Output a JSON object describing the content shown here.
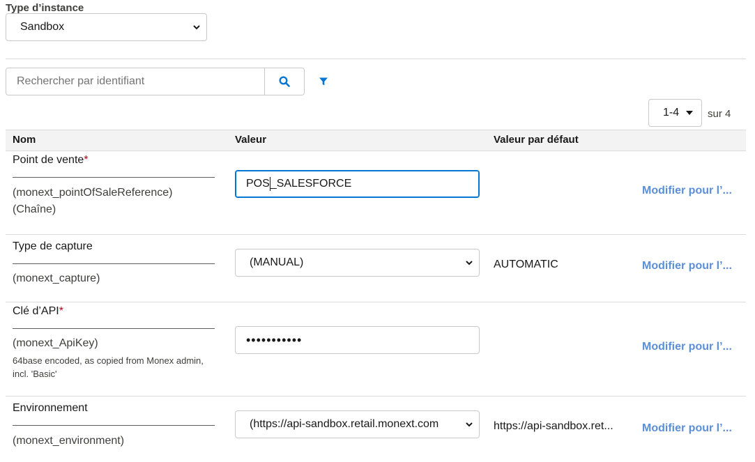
{
  "instance": {
    "label": "Type d’instance",
    "selected": "Sandbox"
  },
  "search": {
    "placeholder": "Rechercher par identifiant"
  },
  "icons": {
    "search": "search-icon",
    "filter": "filter-icon",
    "chevron": "chevron-down-icon"
  },
  "pagination": {
    "range": "1-4",
    "total": "sur 4"
  },
  "table": {
    "headers": {
      "name": "Nom",
      "value": "Valeur",
      "default": "Valeur par défaut"
    },
    "rows": [
      {
        "name": "Point de vente",
        "required": "*",
        "api_name": "(monext_pointOfSaleReference)",
        "type": "(Chaîne)",
        "value_before_cursor": "POS",
        "value_after_cursor": "_SALESFORCE",
        "default": "",
        "action": "Modifier pour l’..."
      },
      {
        "name": "Type de capture",
        "api_name": "(monext_capture)",
        "value": "(MANUAL)",
        "default": "AUTOMATIC",
        "action": "Modifier pour l’..."
      },
      {
        "name": "Clé d’API",
        "required": "*",
        "api_name": "(monext_ApiKey)",
        "description": "64base encoded, as copied from Monex admin, incl. 'Basic'",
        "value": "•••••••••••",
        "default": "",
        "action": "Modifier pour l’..."
      },
      {
        "name": "Environnement",
        "api_name": "(monext_environment)",
        "value": "(https://api-sandbox.retail.monext.com",
        "default": "https://api-sandbox.ret...",
        "action": "Modifier pour l’..."
      }
    ]
  },
  "colors": {
    "accent": "#0176d3",
    "link": "#5b8fd8",
    "required": "#ba0517",
    "header_bg": "#f3f3f3"
  }
}
